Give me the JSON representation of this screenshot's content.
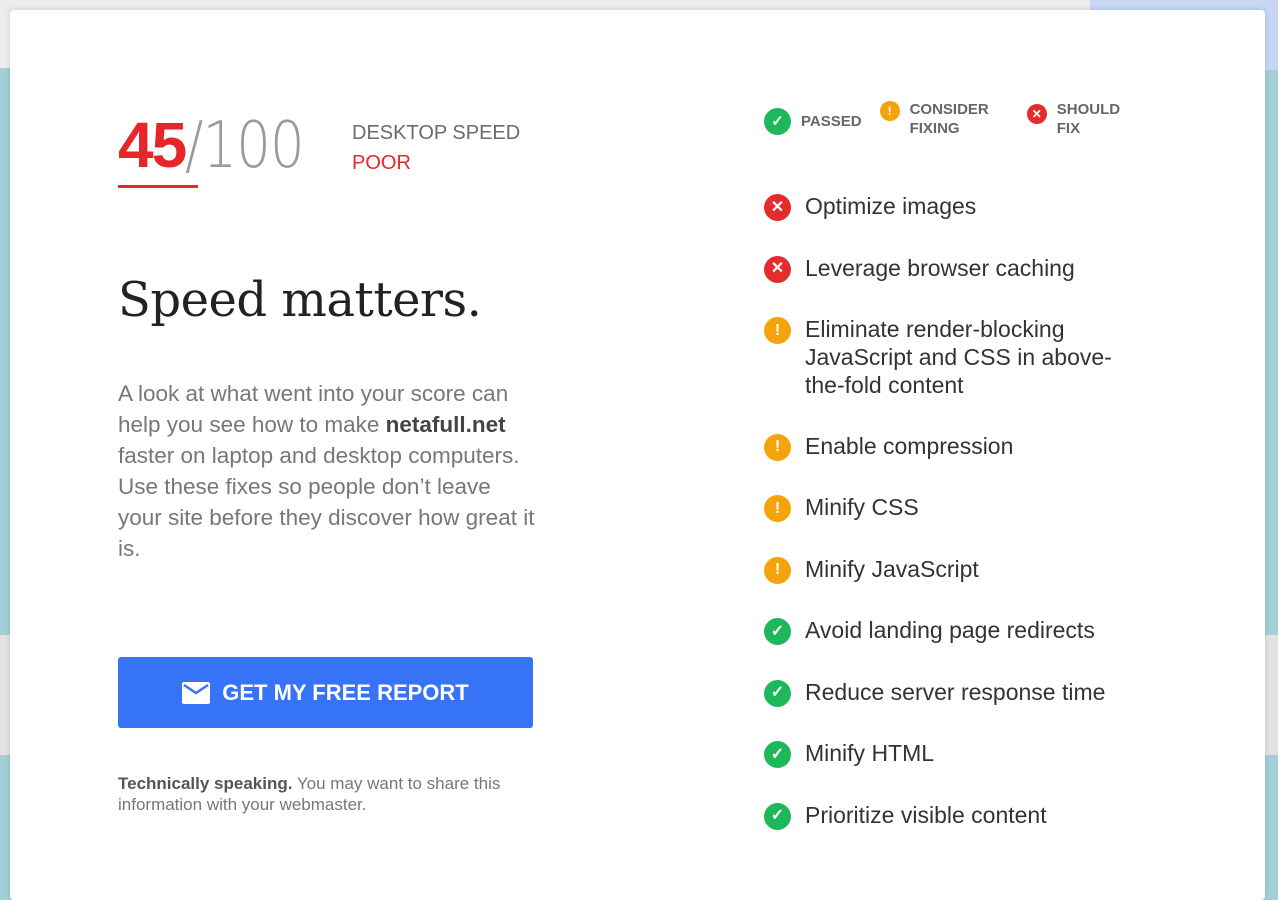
{
  "score": {
    "value": "45",
    "max": "/100",
    "label": "DESKTOP SPEED",
    "rating": "POOR"
  },
  "colors": {
    "poor": "#e8262a",
    "passed": "#1eb85a",
    "consider": "#f5a30a",
    "should_fix": "#e42c2c",
    "button": "#3673f7"
  },
  "heading": "Speed matters.",
  "description": {
    "before": "A look at what went into your score can help you see how to make ",
    "site": "netafull.net",
    "after": " faster on laptop and desktop computers. Use these fixes so people don’t leave your site before they discover how great it is."
  },
  "cta": {
    "icon": "mail-icon",
    "label": "GET MY FREE REPORT"
  },
  "note": {
    "bold": "Technically speaking.",
    "text": " You may want to share this information with your webmaster."
  },
  "legend": {
    "passed": "PASSED",
    "consider_1": "CONSIDER",
    "consider_2": "FIXING",
    "should_1": "SHOULD",
    "should_2": "FIX"
  },
  "rules": [
    {
      "status": "fail",
      "label": "Optimize images"
    },
    {
      "status": "fail",
      "label": "Leverage browser caching"
    },
    {
      "status": "warn",
      "label": "Eliminate render-blocking JavaScript and CSS in above-the-fold content"
    },
    {
      "status": "warn",
      "label": "Enable compression"
    },
    {
      "status": "warn",
      "label": "Minify CSS"
    },
    {
      "status": "warn",
      "label": "Minify JavaScript"
    },
    {
      "status": "pass",
      "label": "Avoid landing page redirects"
    },
    {
      "status": "pass",
      "label": "Reduce server response time"
    },
    {
      "status": "pass",
      "label": "Minify HTML"
    },
    {
      "status": "pass",
      "label": "Prioritize visible content"
    }
  ]
}
